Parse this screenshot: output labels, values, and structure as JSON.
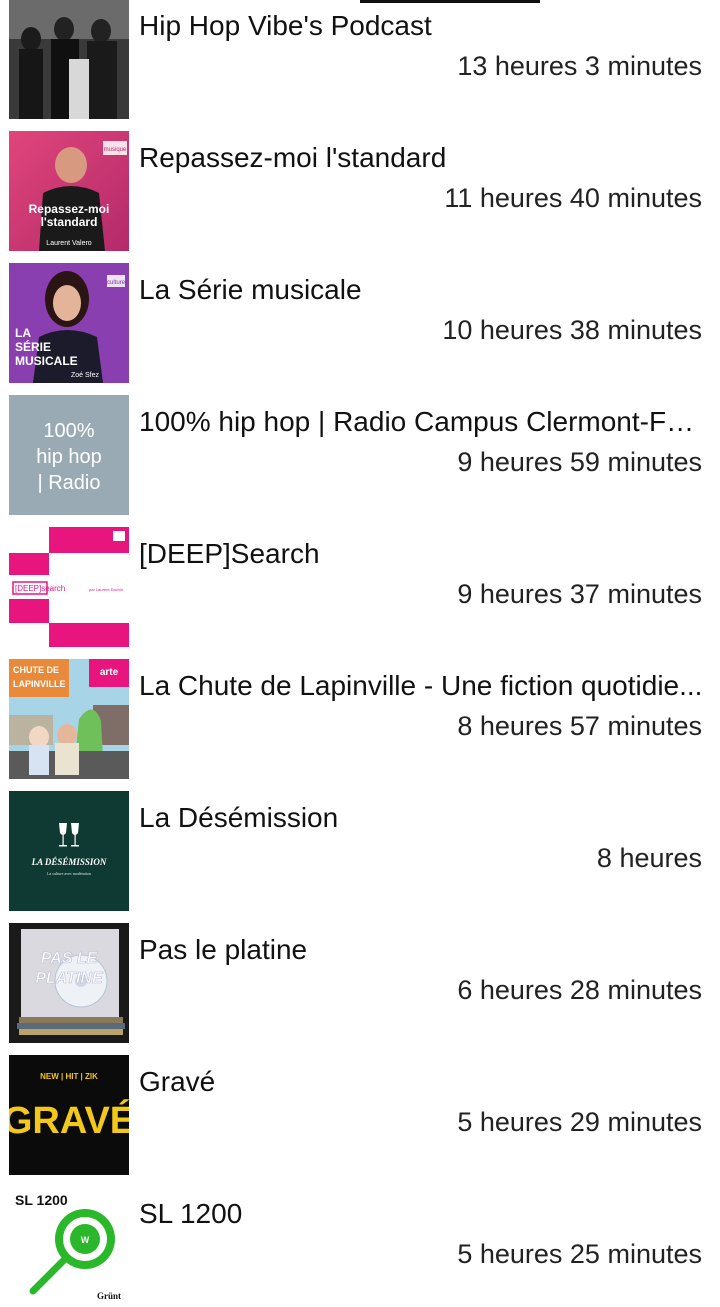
{
  "podcasts": [
    {
      "title": "Hip Hop Vibe's Podcast",
      "duration": "13 heures 3 minutes"
    },
    {
      "title": "Repassez-moi l'standard",
      "duration": "11 heures 40 minutes",
      "art_text": "Repassez-moi l'standard",
      "art_author": "Laurent Valero",
      "art_brand": "musique"
    },
    {
      "title": "La Série musicale",
      "duration": "10 heures 38 minutes",
      "art_text": "LA SÉRIE MUSICALE",
      "art_author": "Zoé Sfez",
      "art_brand": "culture"
    },
    {
      "title": "100% hip hop | Radio Campus Clermont-Fer...",
      "duration": "9 heures 59 minutes",
      "art_text": "100% hip hop | Radio"
    },
    {
      "title": "[DEEP]Search",
      "duration": "9 heures 37 minutes",
      "art_text": "[DEEP]search"
    },
    {
      "title": "La Chute de Lapinville - Une fiction quotidie...",
      "duration": "8 heures 57 minutes",
      "art_text": "LA CHUTE DE LAPINVILLE",
      "art_brand": "arte RADIO"
    },
    {
      "title": "La Désémission",
      "duration": "8 heures",
      "art_text": "LA DÉSÉMISSION"
    },
    {
      "title": "Pas le platine",
      "duration": "6 heures 28 minutes",
      "art_text": "PAS LE PLATINE"
    },
    {
      "title": "Gravé",
      "duration": "5 heures 29 minutes",
      "art_text": "GRAVÉ",
      "art_sub": "NEW | HIT | ZIK"
    },
    {
      "title": "SL 1200",
      "duration": "5 heures 25 minutes",
      "art_text": "SL 1200",
      "art_brand": "Grünt"
    }
  ],
  "colors": {
    "background": "#ffffff",
    "title_text": "#111111",
    "duration_text": "#222222"
  }
}
